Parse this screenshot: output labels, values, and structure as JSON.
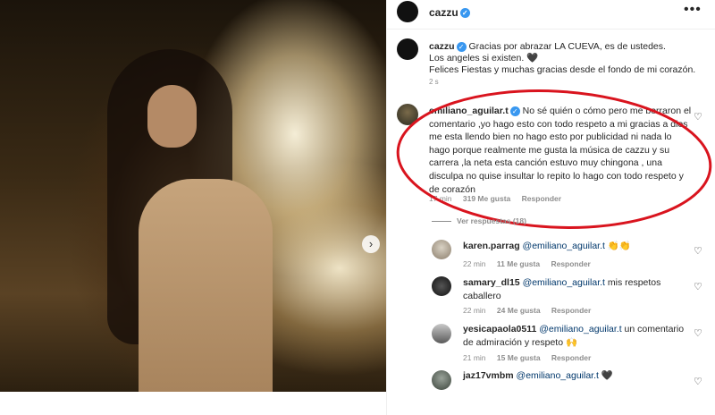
{
  "header": {
    "username": "cazzu",
    "menu_icon": "ellipsis-icon"
  },
  "caption": {
    "username": "cazzu",
    "line1": "Gracias por abrazar LA CUEVA, es de ustedes.",
    "line2": "Los angeles si existen. 🖤",
    "line3": "Felices Fiestas y muchas gracias desde el fondo de mi corazón.",
    "time": "2 s"
  },
  "main_comment": {
    "username": "emiliano_aguilar.t",
    "lines": [
      "No sé quién o cómo pero me borraron el",
      "comentario ,yo hago esto con todo respeto a mi gracias a dios",
      "me esta llendo bien no hago esto por publicidad ni nada lo",
      "hago porque realmente me gusta la música de cazzu y su",
      "carrera ,la neta esta canción estuvo muy chingona , una",
      "disculpa no quise insultar lo repito lo hago con todo respeto y",
      "de corazón"
    ],
    "time": "17 min",
    "likes": "319 Me gusta",
    "reply": "Responder"
  },
  "replies_toggle": "Ver respuestas (18)",
  "replies": [
    {
      "username": "karen.parrag",
      "mention": "@emiliano_aguilar.t",
      "text": " 👏👏",
      "text2": "",
      "time": "22 min",
      "likes": "11 Me gusta",
      "reply": "Responder"
    },
    {
      "username": "samary_dl15",
      "mention": "@emiliano_aguilar.t",
      "text": " mis respetos",
      "text2": "caballero",
      "time": "22 min",
      "likes": "24 Me gusta",
      "reply": "Responder"
    },
    {
      "username": "yesicapaola0511",
      "mention": "@emiliano_aguilar.t",
      "text": " un comentario",
      "text2": "de admiración y respeto 🙌",
      "time": "21 min",
      "likes": "15 Me gusta",
      "reply": "Responder"
    },
    {
      "username": "jaz17vmbm",
      "mention": "@emiliano_aguilar.t",
      "text": " 🖤",
      "text2": "",
      "time": "",
      "likes": "",
      "reply": ""
    }
  ],
  "colors": {
    "annotation_red": "#d9141e",
    "verified_blue": "#3897f0",
    "mention_blue": "#00376b"
  }
}
